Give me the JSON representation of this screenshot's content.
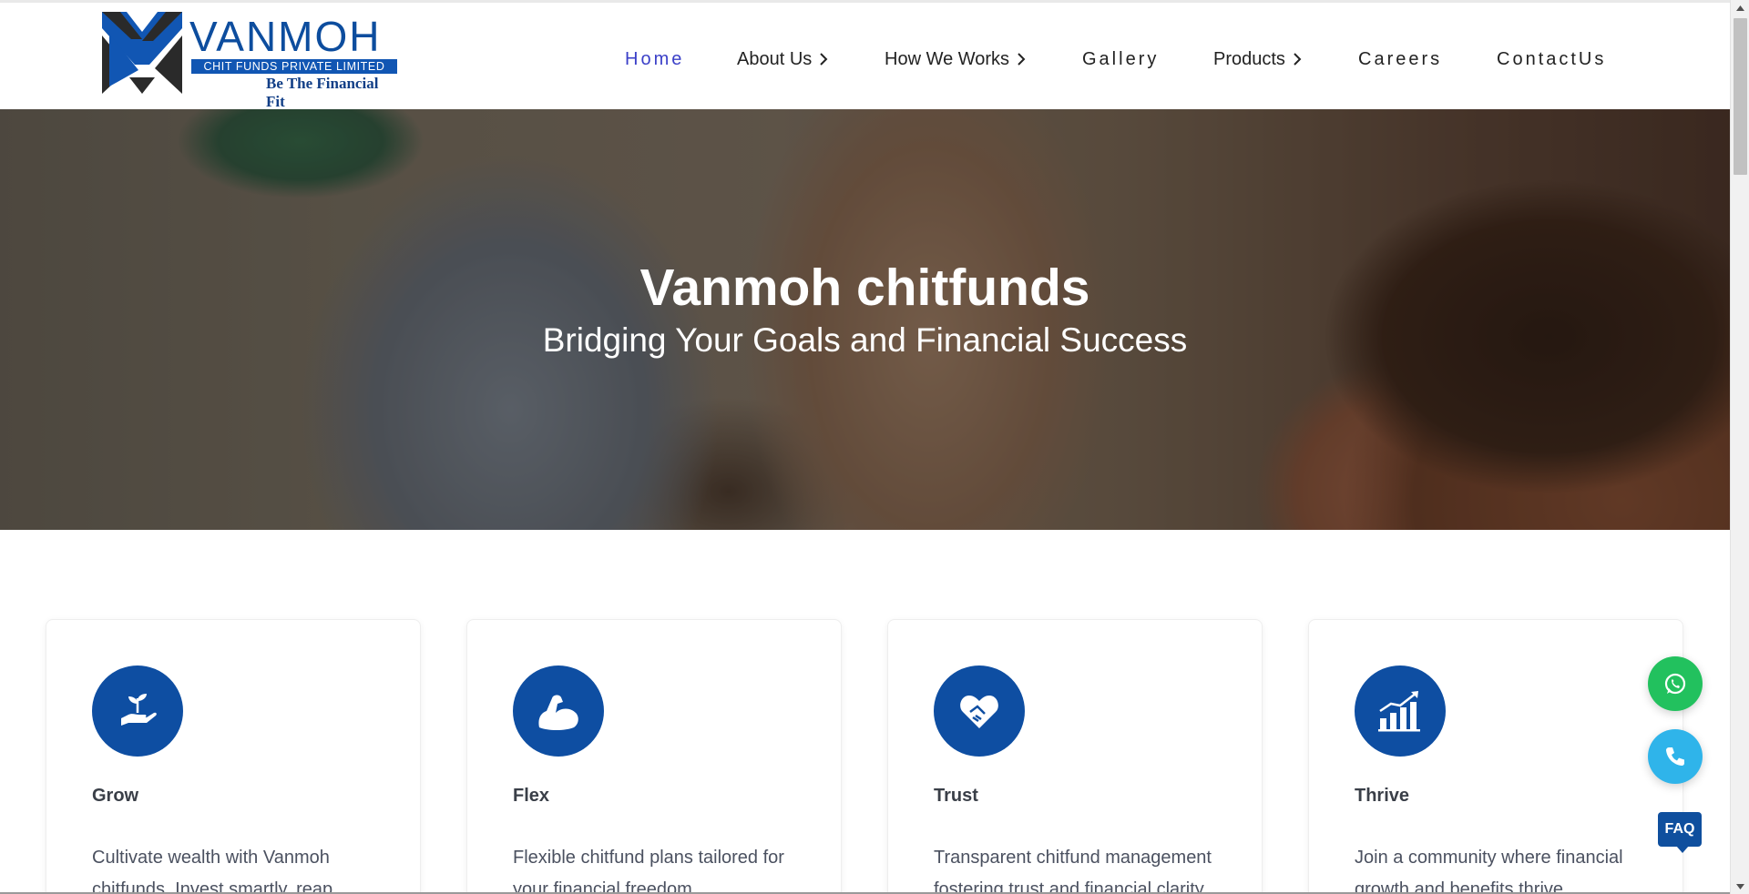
{
  "brand": {
    "name": "VANMOH",
    "subtitle": "CHIT FUNDS PRIVATE LIMITED",
    "tagline": "Be The Financial Fit",
    "colors": {
      "primary": "#0e4ea2",
      "accent_nav": "#3b40c8"
    }
  },
  "nav": {
    "items": [
      {
        "label": "Home",
        "active": true,
        "has_submenu": false
      },
      {
        "label": "About Us",
        "active": false,
        "has_submenu": true
      },
      {
        "label": "How We Works",
        "active": false,
        "has_submenu": true
      },
      {
        "label": "Gallery",
        "active": false,
        "has_submenu": false
      },
      {
        "label": "Products",
        "active": false,
        "has_submenu": true
      },
      {
        "label": "Careers",
        "active": false,
        "has_submenu": false
      },
      {
        "label": "ContactUs",
        "active": false,
        "has_submenu": false
      }
    ]
  },
  "hero": {
    "title": "Vanmoh chitfunds",
    "subtitle": "Bridging Your Goals and Financial Success"
  },
  "features": [
    {
      "title": "Grow",
      "icon": "plant-in-hand-icon",
      "text": "Cultivate wealth with Vanmoh chitfunds. Invest smartly, reap"
    },
    {
      "title": "Flex",
      "icon": "flexed-arm-icon",
      "text": "Flexible chitfund plans tailored for your financial freedom."
    },
    {
      "title": "Trust",
      "icon": "handshake-heart-icon",
      "text": "Transparent chitfund management fostering trust and financial clarity."
    },
    {
      "title": "Thrive",
      "icon": "growth-chart-icon",
      "text": "Join a community where financial growth and benefits thrive."
    }
  ],
  "floating": {
    "whatsapp_icon": "whatsapp-icon",
    "phone_icon": "phone-icon",
    "faq_label": "FAQ"
  }
}
